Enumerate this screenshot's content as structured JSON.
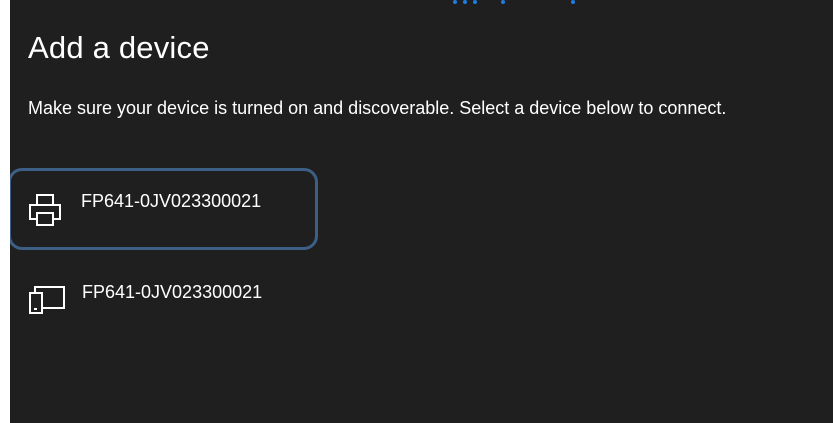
{
  "dialog": {
    "title": "Add a device",
    "description": "Make sure your device is turned on and discoverable. Select a device below to connect."
  },
  "devices": [
    {
      "name": "FP641-0JV023300021",
      "icon": "printer-icon",
      "selected": true
    },
    {
      "name": "FP641-0JV023300021",
      "icon": "display-device-icon",
      "selected": false
    }
  ],
  "colors": {
    "background": "#1f1f1f",
    "text": "#ffffff",
    "selection_border": "#3d5f86",
    "progress": "#1e7de0"
  }
}
